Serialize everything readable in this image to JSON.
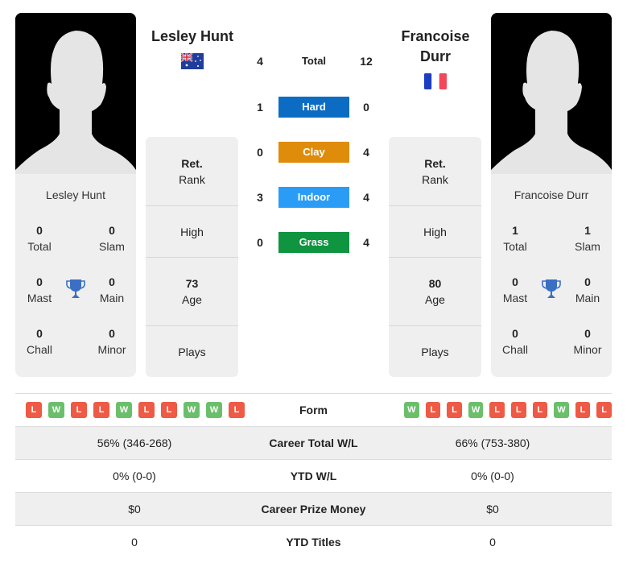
{
  "players": {
    "left": {
      "name": "Lesley Hunt",
      "country": "Australia",
      "flag_icon": "australia-flag-icon",
      "titles": {
        "total": "0",
        "total_label": "Total",
        "slam": "0",
        "slam_label": "Slam",
        "mast": "0",
        "mast_label": "Mast",
        "main": "0",
        "main_label": "Main",
        "chall": "0",
        "chall_label": "Chall",
        "minor": "0",
        "minor_label": "Minor"
      },
      "rank": {
        "value": "Ret.",
        "label": "Rank"
      },
      "high": {
        "value": "",
        "label": "High"
      },
      "age": {
        "value": "73",
        "label": "Age"
      },
      "plays": {
        "value": "",
        "label": "Plays"
      }
    },
    "right": {
      "name": "Francoise Durr",
      "name_line1": "Francoise",
      "name_line2": "Durr",
      "country": "France",
      "flag_icon": "france-flag-icon",
      "titles": {
        "total": "1",
        "total_label": "Total",
        "slam": "1",
        "slam_label": "Slam",
        "mast": "0",
        "mast_label": "Mast",
        "main": "0",
        "main_label": "Main",
        "chall": "0",
        "chall_label": "Chall",
        "minor": "0",
        "minor_label": "Minor"
      },
      "rank": {
        "value": "Ret.",
        "label": "Rank"
      },
      "high": {
        "value": "",
        "label": "High"
      },
      "age": {
        "value": "80",
        "label": "Age"
      },
      "plays": {
        "value": "",
        "label": "Plays"
      }
    }
  },
  "h2h": {
    "total": {
      "label": "Total",
      "left": "4",
      "right": "12"
    },
    "surfaces": [
      {
        "label": "Hard",
        "left": "1",
        "right": "0",
        "color": "#0c6cc4"
      },
      {
        "label": "Clay",
        "left": "0",
        "right": "4",
        "color": "#df8c0b"
      },
      {
        "label": "Indoor",
        "left": "3",
        "right": "4",
        "color": "#2b9cf6"
      },
      {
        "label": "Grass",
        "left": "0",
        "right": "4",
        "color": "#0f9440"
      }
    ]
  },
  "form": {
    "label": "Form",
    "left": [
      "L",
      "W",
      "L",
      "L",
      "W",
      "L",
      "L",
      "W",
      "W",
      "L"
    ],
    "right": [
      "W",
      "L",
      "L",
      "W",
      "L",
      "L",
      "L",
      "W",
      "L",
      "L"
    ]
  },
  "comparison": [
    {
      "label": "Career Total W/L",
      "left": "56% (346-268)",
      "right": "66% (753-380)"
    },
    {
      "label": "YTD W/L",
      "left": "0% (0-0)",
      "right": "0% (0-0)"
    },
    {
      "label": "Career Prize Money",
      "left": "$0",
      "right": "$0"
    },
    {
      "label": "YTD Titles",
      "left": "0",
      "right": "0"
    }
  ],
  "colors": {
    "win": "#6bbf6b",
    "loss": "#ee5a45",
    "trophy": "#3a6fc4",
    "card_bg": "#efefef"
  }
}
